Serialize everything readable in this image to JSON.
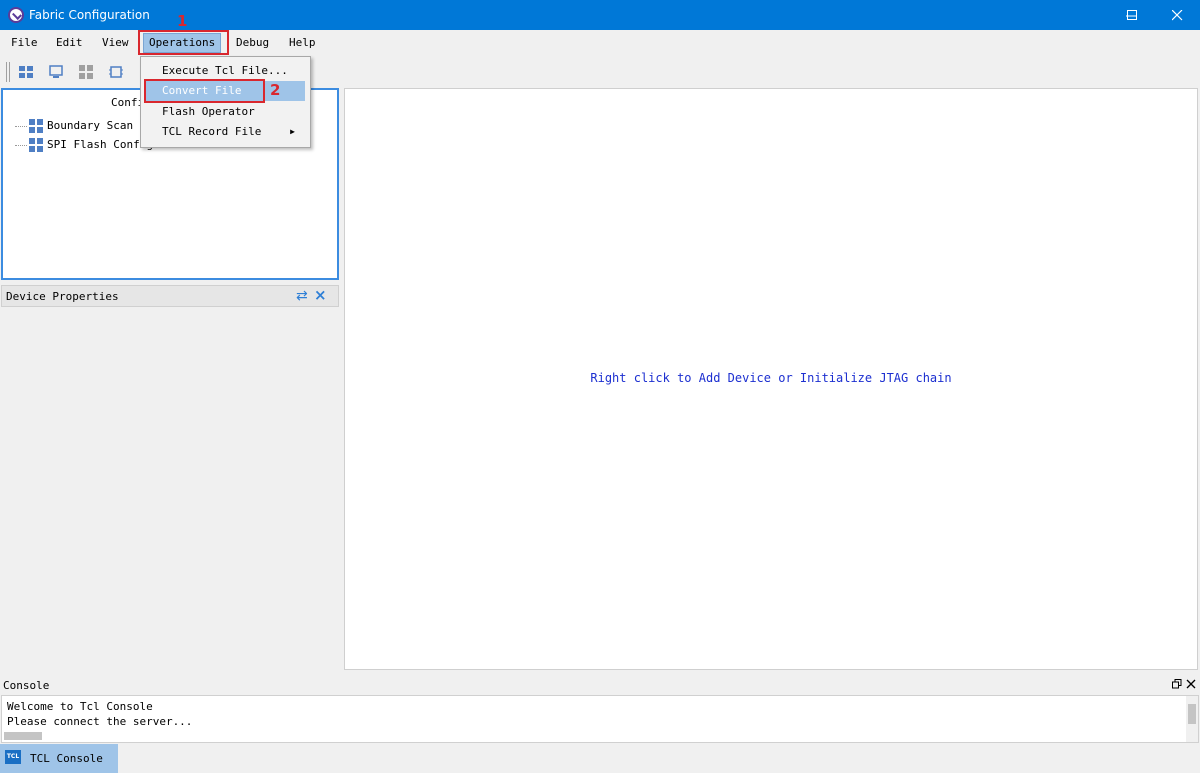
{
  "window": {
    "title": "Fabric Configuration"
  },
  "menubar": {
    "items": [
      {
        "label": "File"
      },
      {
        "label": "Edit"
      },
      {
        "label": "View"
      },
      {
        "label": "Operations"
      },
      {
        "label": "Debug"
      },
      {
        "label": "Help"
      }
    ]
  },
  "annotations": {
    "step1": "1",
    "step2": "2"
  },
  "dropdown": {
    "items": [
      {
        "label": "Execute Tcl File..."
      },
      {
        "label": "Convert File"
      },
      {
        "label": "Flash Operator"
      },
      {
        "label": "TCL Record File"
      }
    ]
  },
  "config_panel": {
    "header": "Confi",
    "items": [
      {
        "label": "Boundary Scan"
      },
      {
        "label": "SPI Flash Configuration"
      }
    ]
  },
  "device_properties": {
    "label": "Device Properties"
  },
  "canvas": {
    "hint": "Right click to Add Device or Initialize JTAG chain"
  },
  "console": {
    "label": "Console",
    "lines": [
      "Welcome to Tcl Console",
      "Please connect the server..."
    ]
  },
  "statusbar": {
    "tab_label": "TCL Console",
    "tab_icon_text": "TCL"
  },
  "colors": {
    "titlebar": "#0078d7",
    "highlight": "#9fc4e8",
    "annotation": "#d9272e",
    "hint_text": "#1c2fd0"
  }
}
